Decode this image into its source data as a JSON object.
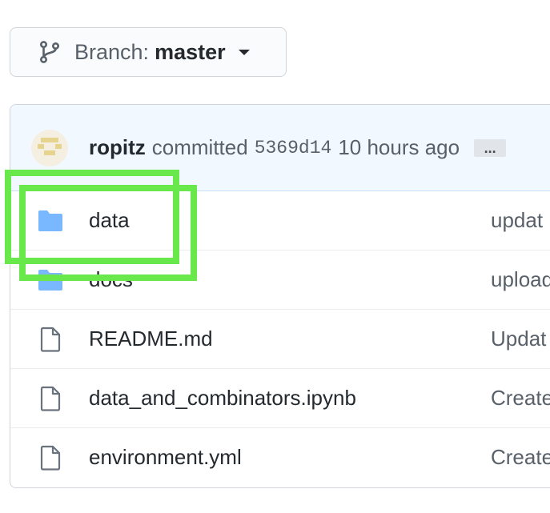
{
  "branch": {
    "prefix": "Branch:",
    "name": "master"
  },
  "commit": {
    "author": "ropitz",
    "verb": "committed",
    "sha": "5369d14",
    "time": "10 hours ago",
    "more_label": "..."
  },
  "files": [
    {
      "name": "data",
      "type": "folder",
      "message": "updat"
    },
    {
      "name": "docs",
      "type": "folder",
      "message": "upload"
    },
    {
      "name": "README.md",
      "type": "file",
      "message": "Updat"
    },
    {
      "name": "data_and_combinators.ipynb",
      "type": "file",
      "message": "Create"
    },
    {
      "name": "environment.yml",
      "type": "file",
      "message": "Create"
    }
  ],
  "colors": {
    "highlight": "#68e84a",
    "folder": "#79b8ff",
    "commit_bar": "#f1f8ff"
  }
}
